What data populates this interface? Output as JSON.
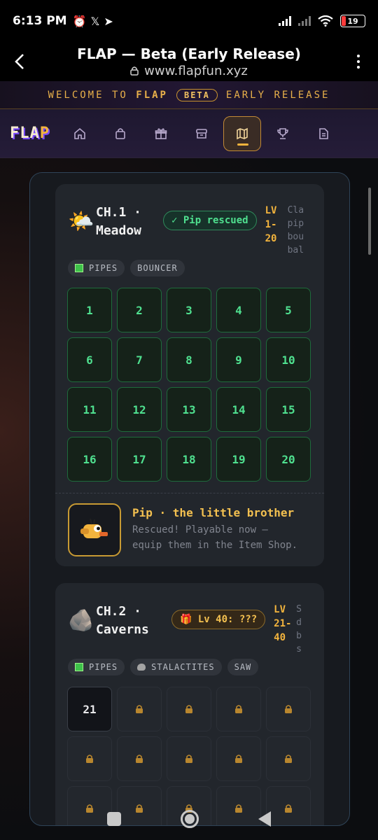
{
  "status_bar": {
    "time": "6:13 PM",
    "battery": "19"
  },
  "browser": {
    "title": "FLAP — Beta (Early Release)",
    "url": "www.flapfun.xyz"
  },
  "banner": {
    "welcome": "WELCOME TO",
    "brand": "FLAP",
    "beta": "BETA",
    "early": "EARLY RELEASE"
  },
  "nav": {
    "logo_a": "FLA",
    "logo_b": "P",
    "items": [
      "home-icon",
      "shopping-bag-icon",
      "gift-icon",
      "storage-icon",
      "map-icon",
      "trophy-icon",
      "document-icon"
    ],
    "active": "map-icon"
  },
  "chapters": [
    {
      "emoji": "🌤️",
      "name_line1": "CH.1 ·",
      "name_line2": "Meadow",
      "badge": "✓ Pip rescued",
      "lv_line1": "LV",
      "lv_line2": "1-",
      "lv_line3": "20",
      "desc": [
        "Cla",
        "pip",
        "bou",
        "bal"
      ],
      "tags": [
        "PIPES",
        "BOUNCER"
      ],
      "levels": [
        "1",
        "2",
        "3",
        "4",
        "5",
        "6",
        "7",
        "8",
        "9",
        "10",
        "11",
        "12",
        "13",
        "14",
        "15",
        "16",
        "17",
        "18",
        "19",
        "20"
      ],
      "rescue": {
        "title": "Pip · the little brother",
        "line1": "Rescued! Playable now —",
        "line2": "equip them in the Item Shop."
      }
    },
    {
      "emoji": "🪨",
      "name_line1": "CH.2 ·",
      "name_line2": "Caverns",
      "badge": "🎁 Lv 40: ???",
      "lv_line1": "LV",
      "lv_line2": "21-",
      "lv_line3": "40",
      "desc": [
        "S",
        "d",
        "b",
        "s"
      ],
      "tags": [
        "PIPES",
        "STALACTITES",
        "SAW"
      ],
      "first_level": "21"
    }
  ],
  "colors": {
    "accent": "#f3b43d",
    "success": "#4fe08f",
    "modal_border": "#2f4458"
  }
}
